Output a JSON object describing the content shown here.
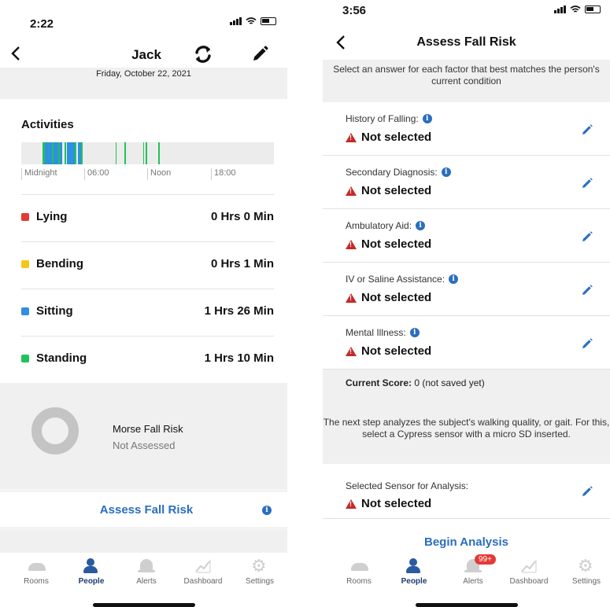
{
  "left": {
    "status": {
      "time": "2:22"
    },
    "header": {
      "title": "Jack"
    },
    "date": "Friday, October 22, 2021",
    "activities": {
      "heading": "Activities",
      "timeline_labels": [
        "Midnight",
        "06:00",
        "Noon",
        "18:00"
      ],
      "rows": [
        {
          "name": "Lying",
          "duration": "0 Hrs 0 Min",
          "color": "#e53935"
        },
        {
          "name": "Bending",
          "duration": "0 Hrs 1 Min",
          "color": "#f5c518"
        },
        {
          "name": "Sitting",
          "duration": "1 Hrs 26 Min",
          "color": "#2f8fe0"
        },
        {
          "name": "Standing",
          "duration": "1 Hrs 10 Min",
          "color": "#22c25a"
        }
      ]
    },
    "risk": {
      "title": "Morse Fall Risk",
      "status": "Not Assessed"
    },
    "assess_label": "Assess Fall Risk"
  },
  "right": {
    "status": {
      "time": "3:56"
    },
    "header": {
      "title": "Assess Fall Risk"
    },
    "description": "Select an answer for each factor that best matches the person's current condition",
    "factors": [
      {
        "label": "History of Falling:",
        "value": "Not selected"
      },
      {
        "label": "Secondary Diagnosis:",
        "value": "Not selected"
      },
      {
        "label": "Ambulatory Aid:",
        "value": "Not selected"
      },
      {
        "label": "IV or Saline Assistance:",
        "value": "Not selected"
      },
      {
        "label": "Mental Illness:",
        "value": "Not selected"
      }
    ],
    "score": {
      "label": "Current Score:",
      "value": "0 (not saved yet)"
    },
    "next_step": "The next step analyzes the subject's walking quality, or gait. For this, select a Cypress sensor with a micro SD inserted.",
    "sensor": {
      "label": "Selected Sensor for Analysis:",
      "value": "Not selected"
    },
    "begin_label": "Begin Analysis",
    "alerts_badge": "99+"
  },
  "tabs": [
    "Rooms",
    "People",
    "Alerts",
    "Dashboard",
    "Settings"
  ],
  "colors": {
    "accent": "#2a6ebf",
    "warning": "#c62828",
    "band": "#f0f0f0"
  }
}
